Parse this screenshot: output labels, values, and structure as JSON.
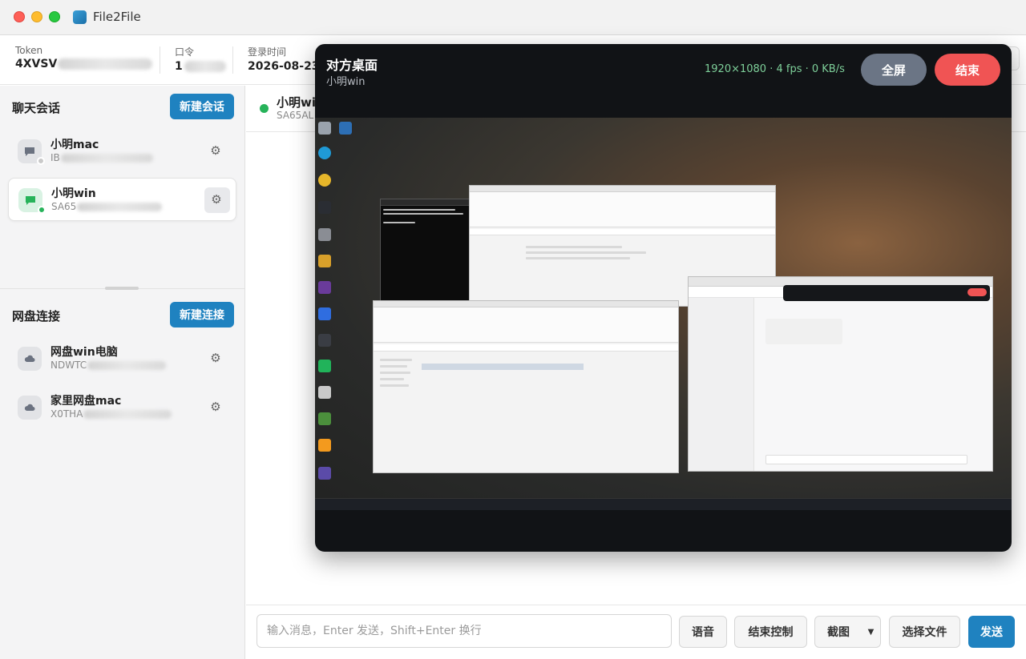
{
  "window": {
    "title": "File2File"
  },
  "header": {
    "token_label": "Token",
    "token_value": "4XVSV",
    "password_label": "口令",
    "password_value": "1",
    "login_label": "登录时间",
    "login_value": "2026-08-23"
  },
  "sidebar": {
    "chat_title": "聊天会话",
    "new_chat_label": "新建会话",
    "chats": [
      {
        "name": "小明mac",
        "sub": "IB",
        "online": false
      },
      {
        "name": "小明win",
        "sub": "SA65",
        "online": true
      }
    ],
    "disk_title": "网盘连接",
    "new_disk_label": "新建连接",
    "disks": [
      {
        "name": "网盘win电脑",
        "sub": "NDWTC"
      },
      {
        "name": "家里网盘mac",
        "sub": "X0THA"
      }
    ]
  },
  "chat": {
    "peer_name": "小明wi",
    "peer_sub": "SA65AL"
  },
  "composer": {
    "placeholder": "输入消息，Enter 发送，Shift+Enter 换行",
    "voice_label": "语音",
    "end_control_label": "结束控制",
    "screenshot_label": "截图",
    "screenshot_caret": "▼",
    "choose_file_label": "选择文件",
    "send_label": "发送"
  },
  "remote": {
    "title": "对方桌面",
    "subtitle": "小明win",
    "stats": "1920×1080 · 4 fps · 0 KB/s",
    "fullscreen_label": "全屏",
    "end_label": "结束"
  },
  "icons": {
    "chat": "chat-bubble-icon",
    "cloud": "cloud-icon",
    "gear": "⚙"
  },
  "colors": {
    "accent": "#1f82c0",
    "online": "#27b35a",
    "end": "#f05454",
    "stats": "#7ed09a"
  }
}
